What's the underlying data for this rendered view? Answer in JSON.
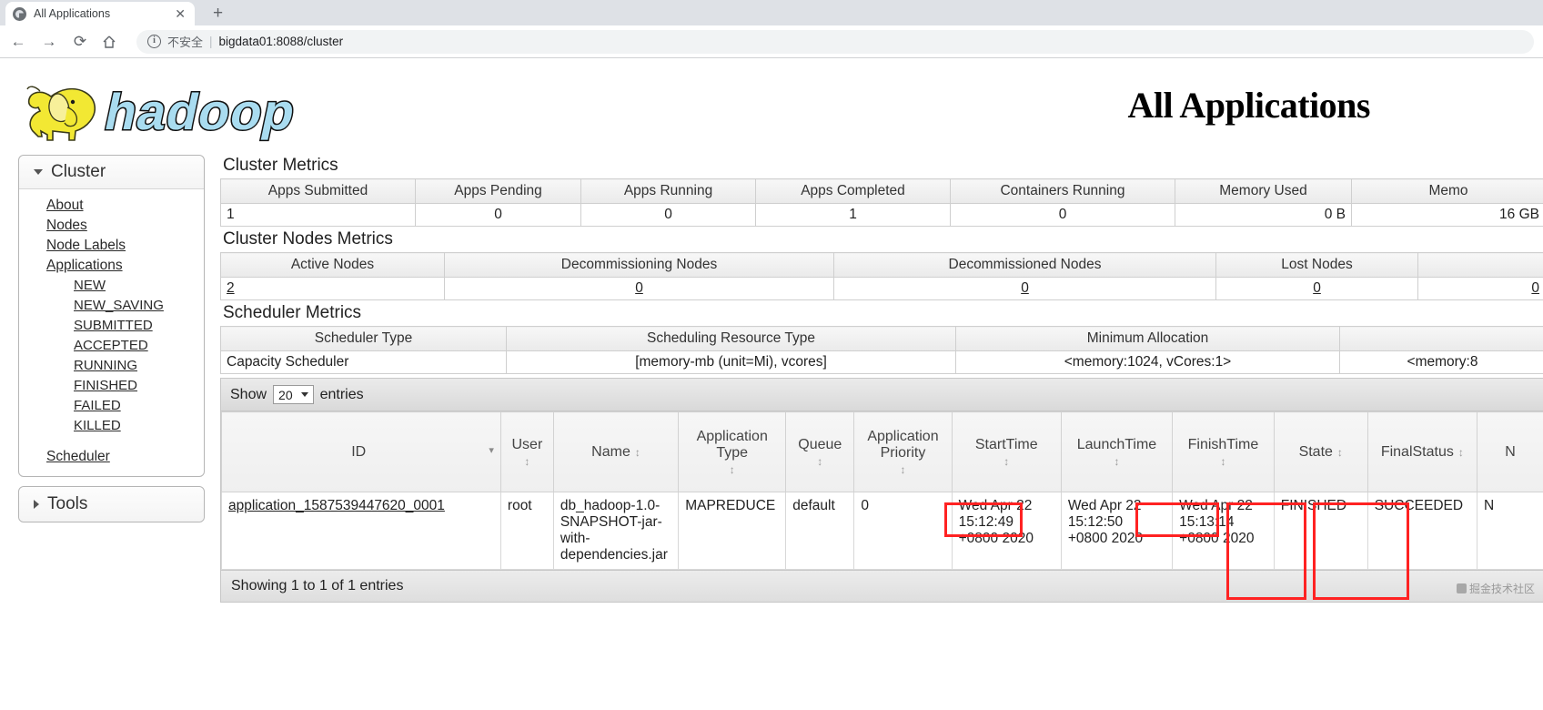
{
  "browser": {
    "tab_title": "All Applications",
    "tab_close": "✕",
    "new_tab": "+",
    "back": "←",
    "forward": "→",
    "reload": "⟳",
    "info_glyph": "i",
    "security_label": "不安全",
    "separator": "|",
    "url": "bigdata01:8088/cluster"
  },
  "header": {
    "logo_text": "hadoop",
    "page_title": "All Applications"
  },
  "sidebar": {
    "cluster_label": "Cluster",
    "items": [
      {
        "label": "About"
      },
      {
        "label": "Nodes"
      },
      {
        "label": "Node Labels"
      },
      {
        "label": "Applications"
      }
    ],
    "app_states": [
      {
        "label": "NEW"
      },
      {
        "label": "NEW_SAVING"
      },
      {
        "label": "SUBMITTED"
      },
      {
        "label": "ACCEPTED"
      },
      {
        "label": "RUNNING"
      },
      {
        "label": "FINISHED"
      },
      {
        "label": "FAILED"
      },
      {
        "label": "KILLED"
      }
    ],
    "scheduler_label": "Scheduler",
    "tools_label": "Tools"
  },
  "cluster_metrics": {
    "title": "Cluster Metrics",
    "headers": [
      "Apps Submitted",
      "Apps Pending",
      "Apps Running",
      "Apps Completed",
      "Containers Running",
      "Memory Used",
      "Memo"
    ],
    "values": [
      "1",
      "0",
      "0",
      "1",
      "0",
      "0 B",
      "16 GB"
    ]
  },
  "cluster_nodes_metrics": {
    "title": "Cluster Nodes Metrics",
    "headers": [
      "Active Nodes",
      "Decommissioning Nodes",
      "Decommissioned Nodes",
      "Lost Nodes",
      ""
    ],
    "values": [
      "2",
      "0",
      "0",
      "0",
      "0"
    ]
  },
  "scheduler_metrics": {
    "title": "Scheduler Metrics",
    "headers": [
      "Scheduler Type",
      "Scheduling Resource Type",
      "Minimum Allocation",
      ""
    ],
    "values": [
      "Capacity Scheduler",
      "[memory-mb (unit=Mi), vcores]",
      "<memory:1024, vCores:1>",
      "<memory:8"
    ]
  },
  "apps_table": {
    "show_label": "Show",
    "entries_label": "entries",
    "page_size": "20",
    "columns": [
      {
        "label": "ID",
        "sort": "desc"
      },
      {
        "label": "User",
        "sort": "both"
      },
      {
        "label": "Name",
        "sort": "both"
      },
      {
        "label": "Application Type",
        "sort": "both"
      },
      {
        "label": "Queue",
        "sort": "both"
      },
      {
        "label": "Application Priority",
        "sort": "both"
      },
      {
        "label": "StartTime",
        "sort": "both",
        "highlight": true
      },
      {
        "label": "LaunchTime",
        "sort": "both"
      },
      {
        "label": "FinishTime",
        "sort": "both",
        "highlight": true
      },
      {
        "label": "State",
        "sort": "both",
        "highlight": true
      },
      {
        "label": "FinalStatus",
        "sort": "both",
        "highlight": true
      },
      {
        "label": "N",
        "sort": "none"
      }
    ],
    "rows": [
      {
        "id": "application_1587539447620_0001",
        "user": "root",
        "name": "db_hadoop-1.0-SNAPSHOT-jar-with-dependencies.jar",
        "app_type": "MAPREDUCE",
        "queue": "default",
        "priority": "0",
        "start_time": "Wed Apr 22 15:12:49 +0800 2020",
        "launch_time": "Wed Apr 22 15:12:50 +0800 2020",
        "finish_time": "Wed Apr 22 15:13:14 +0800 2020",
        "state": "FINISHED",
        "final_status": "SUCCEEDED",
        "extra": "N"
      }
    ],
    "footer": "Showing 1 to 1 of 1 entries"
  },
  "watermark": {
    "text": "掘金技术社区"
  },
  "colors": {
    "annotation": "#ff2222",
    "logo_yellow": "#f2e833",
    "logo_blue": "#a9dcf0"
  }
}
